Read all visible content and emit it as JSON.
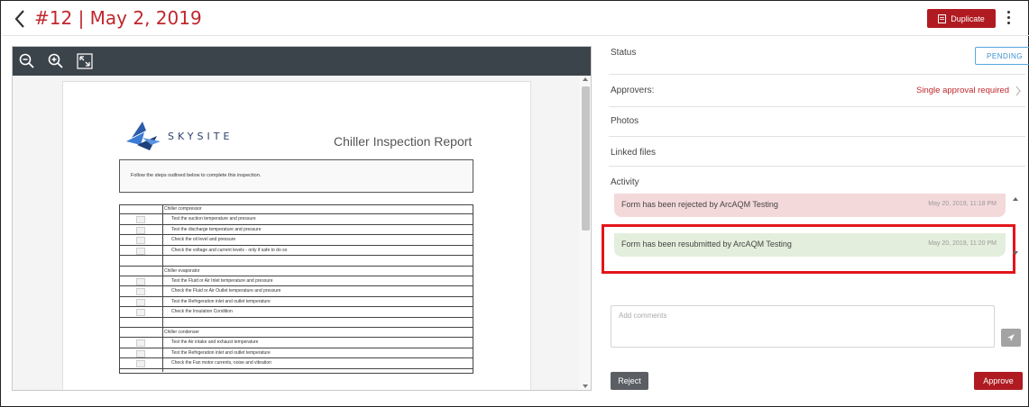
{
  "header": {
    "title": "#12 | May 2, 2019",
    "duplicate_label": "Duplicate"
  },
  "document": {
    "brand": "SKYSITE",
    "report_title": "Chiller Inspection Report",
    "instructions": "Follow the steps outlined below to complete this inspection.",
    "rows": [
      {
        "type": "section",
        "label": "Chiller compressor"
      },
      {
        "type": "item",
        "label": "Test the suction temperature and pressure"
      },
      {
        "type": "item",
        "label": "Test the discharge temperature and pressure"
      },
      {
        "type": "item",
        "label": "Check the oil level and pressure"
      },
      {
        "type": "item",
        "label": "Check the voltage and current levels - only if safe to do so"
      },
      {
        "type": "blank",
        "label": ""
      },
      {
        "type": "section",
        "label": "Chiller evaporator"
      },
      {
        "type": "item",
        "label": "Test the Fluid or Air Inlet temperature and pressure"
      },
      {
        "type": "item",
        "label": "Check the Fluid or Air Outlet temperature and pressure"
      },
      {
        "type": "item",
        "label": "Test the Refrigeration inlet and outlet temperature"
      },
      {
        "type": "item",
        "label": "Check the Insulation Condition"
      },
      {
        "type": "blank",
        "label": ""
      },
      {
        "type": "section",
        "label": "Chiller condenser"
      },
      {
        "type": "item",
        "label": "Test the Air intake and exhaust temperature"
      },
      {
        "type": "item",
        "label": "Test the Refrigeration inlet and outlet temperature"
      },
      {
        "type": "item",
        "label": "Check the Fan motor currents, noise and vibration"
      }
    ]
  },
  "panel": {
    "status_label": "Status",
    "status_value": "PENDING",
    "approvers_label": "Approvers:",
    "approvers_value": "Single approval required",
    "photos_label": "Photos",
    "linked_files_label": "Linked files",
    "activity_label": "Activity",
    "activity": [
      {
        "message": "Form has been rejected by ArcAQM Testing",
        "time": "May 20, 2019, 11:18 PM",
        "kind": "rejected"
      },
      {
        "message": "Form has been resubmitted by ArcAQM Testing",
        "time": "May 20, 2019, 11:20 PM",
        "kind": "resubmitted"
      }
    ],
    "comment_placeholder": "Add comments",
    "reject_label": "Reject",
    "approve_label": "Approve"
  },
  "colors": {
    "accent_red": "#b01b22",
    "title_red": "#c0272d",
    "pending_blue": "#3a8fd0",
    "highlight_red": "#e3151a"
  }
}
